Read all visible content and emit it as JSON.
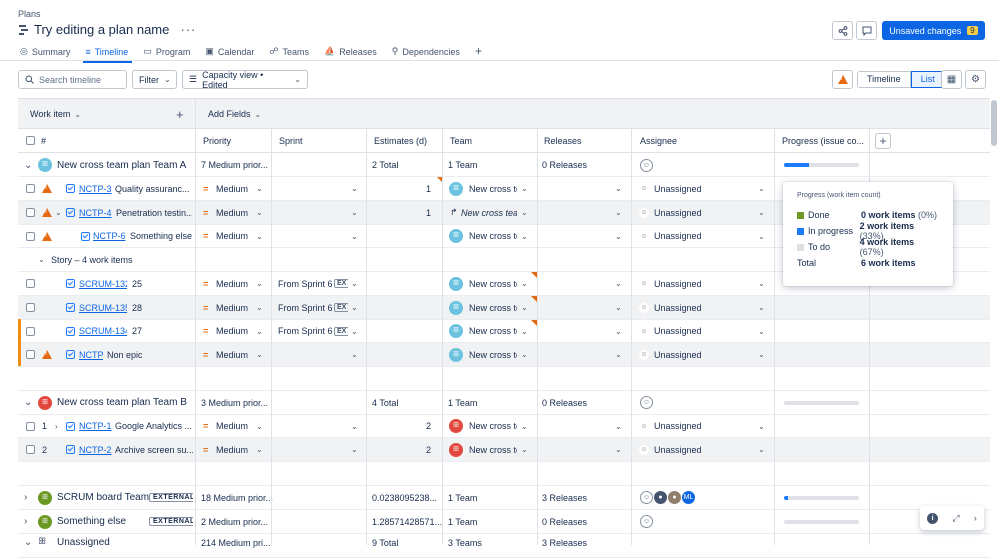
{
  "header": {
    "breadcrumb": "Plans",
    "title": "Try editing a plan name",
    "more_label": "···",
    "unsaved_label": "Unsaved changes",
    "unsaved_count": "9"
  },
  "tabs": [
    {
      "label": "Summary"
    },
    {
      "label": "Timeline"
    },
    {
      "label": "Program"
    },
    {
      "label": "Calendar"
    },
    {
      "label": "Teams"
    },
    {
      "label": "Releases"
    },
    {
      "label": "Dependencies"
    }
  ],
  "toolbar": {
    "search_placeholder": "Search timeline",
    "filter_label": "Filter",
    "view_label": "Capacity view • Edited",
    "timeline_label": "Timeline",
    "list_label": "List"
  },
  "grid": {
    "work_item_label": "Work item",
    "add_fields_label": "Add Fields",
    "columns": {
      "hash": "#",
      "priority": "Priority",
      "sprint": "Sprint",
      "estimates": "Estimates (d)",
      "team": "Team",
      "releases": "Releases",
      "assignee": "Assignee",
      "progress": "Progress (issue co..."
    },
    "rows": [
      {
        "key": "",
        "summary": "New cross team plan Team A",
        "priority": "7 Medium prior...",
        "sprint": "",
        "estimate": "2 Total",
        "team": "1 Team",
        "releases": "0 Releases"
      },
      {
        "key": "NCTP-3",
        "summary": "Quality assuranc...",
        "priority": "Medium",
        "sprint": "",
        "estimate": "1",
        "team": "New cross te",
        "assignee": "Unassigned"
      },
      {
        "key": "NCTP-4",
        "summary": "Penetration testin...",
        "priority": "Medium",
        "sprint": "",
        "estimate": "1",
        "team": "New cross tean",
        "assignee": "Unassigned"
      },
      {
        "key": "NCTP-6",
        "summary": "Something else",
        "priority": "Medium",
        "sprint": "",
        "estimate": "",
        "team": "New cross te",
        "assignee": "Unassigned"
      },
      {
        "story_label": "Story – 4 work items"
      },
      {
        "key": "SCRUM-132",
        "summary": "25",
        "priority": "Medium",
        "sprint": "From Sprint 6",
        "ex": "EX",
        "team": "New cross te",
        "assignee": "Unassigned"
      },
      {
        "key": "SCRUM-135",
        "summary": "28",
        "priority": "Medium",
        "sprint": "From Sprint 6",
        "ex": "EX",
        "team": "New cross te",
        "assignee": "Unassigned"
      },
      {
        "key": "SCRUM-134",
        "summary": "27",
        "priority": "Medium",
        "sprint": "From Sprint 6",
        "ex": "EX",
        "team": "New cross te",
        "assignee": "Unassigned"
      },
      {
        "key": "NCTP",
        "summary": "Non epic",
        "priority": "Medium",
        "sprint": "",
        "team": "New cross te",
        "assignee": "Unassigned"
      },
      {
        "key": "",
        "summary": "New cross team plan Team B",
        "priority": "3 Medium prior...",
        "estimate": "4 Total",
        "team": "1 Team",
        "releases": "0 Releases"
      },
      {
        "num": "1",
        "key": "NCTP-1",
        "summary": "Google Analytics ...",
        "priority": "Medium",
        "estimate": "2",
        "team": "New cross te",
        "assignee": "Unassigned"
      },
      {
        "num": "2",
        "key": "NCTP-2",
        "summary": "Archive screen su...",
        "priority": "Medium",
        "estimate": "2",
        "team": "New cross te",
        "assignee": "Unassigned"
      },
      {
        "summary": "SCRUM board Team",
        "badge": "EXTERNAL",
        "priority": "18 Medium prior...",
        "estimate": "0.0238095238...",
        "team": "1 Team",
        "releases": "3 Releases",
        "avatar_ml": "ML"
      },
      {
        "summary": "Something else",
        "badge": "EXTERNAL",
        "priority": "2 Medium prior...",
        "estimate": "1.28571428571...",
        "team": "1 Team",
        "releases": "0 Releases"
      },
      {
        "summary": "Unassigned",
        "priority": "214 Medium pri...",
        "estimate": "9 Total",
        "team": "3 Teams",
        "releases": "3 Releases"
      }
    ]
  },
  "progress_popup": {
    "title": "Progress (work item count)",
    "items": [
      {
        "label": "Done",
        "value": "0 work items",
        "pct": "(0%)",
        "color": "#6a9a23"
      },
      {
        "label": "In progress",
        "value": "2 work items",
        "pct": "(33%)",
        "color": "#1d7afc"
      },
      {
        "label": "To do",
        "value": "4 work items",
        "pct": "(67%)",
        "color": "#dcdfe4"
      }
    ],
    "total_label": "Total",
    "total_value": "6 work items"
  },
  "progress_levels": {
    "team_a": 0.33,
    "team_b": 0,
    "scrum_board": 0.05,
    "something_else": 0
  },
  "colors": {
    "accent": "#0c66e4",
    "warning": "#e56910",
    "unsaved_badge": "#f5cd47"
  }
}
